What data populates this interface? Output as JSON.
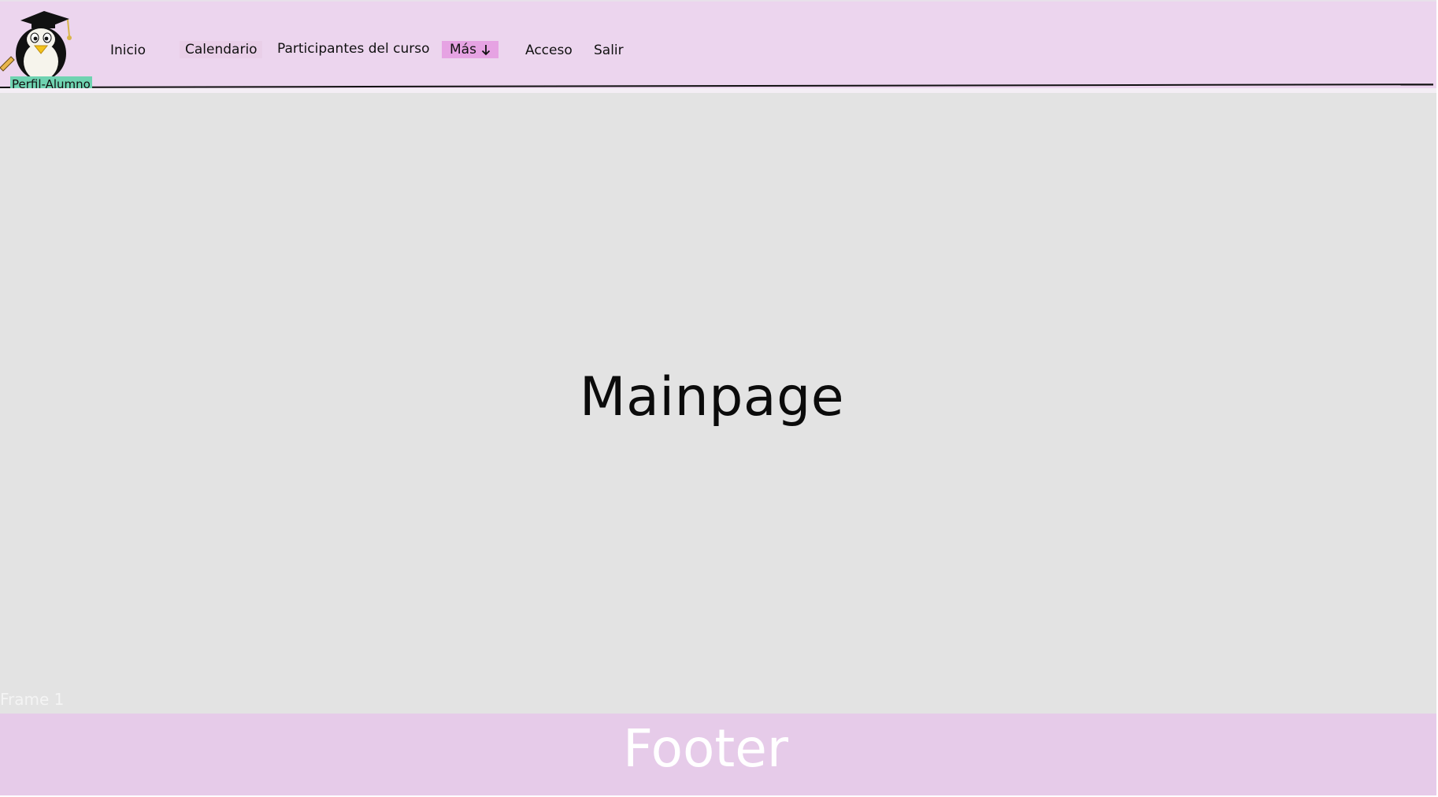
{
  "header": {
    "logo_label": "Perfil-Alumno",
    "nav": {
      "inicio": "Inicio",
      "calendario": "Calendario",
      "participantes": "Participantes del curso",
      "mas": "Más",
      "acceso": "Acceso",
      "salir": "Salir"
    }
  },
  "main": {
    "title": "Mainpage",
    "frame_label": "Frame 1"
  },
  "footer": {
    "title": "Footer"
  },
  "icons": {
    "logo": "graduate-penguin-icon",
    "dropdown": "arrow-down-icon"
  },
  "colors": {
    "header_bg": "#ecd5ee",
    "main_bg": "#e3e3e3",
    "footer_bg": "#e6cbe9",
    "label_bg": "#6fd3b1",
    "mas_bg": "#e6a3e3"
  }
}
